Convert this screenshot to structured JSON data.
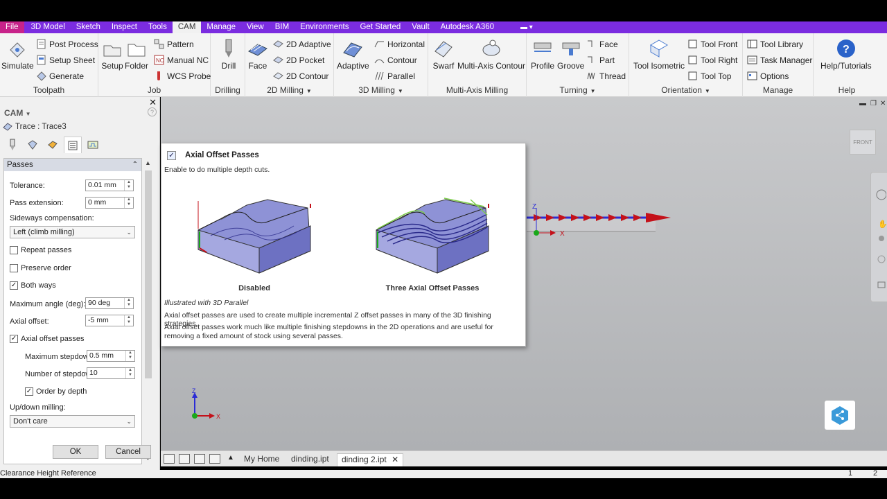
{
  "menu": {
    "items": [
      "File",
      "3D Model",
      "Sketch",
      "Inspect",
      "Tools",
      "CAM",
      "Manage",
      "View",
      "BIM",
      "Environments",
      "Get Started",
      "Vault",
      "Autodesk A360"
    ],
    "active": "CAM"
  },
  "colors": {
    "menubar": "#7b2ce0",
    "file_tab": "#c8238a",
    "accent_blue": "#2a62c9"
  },
  "ribbon": {
    "toolpath": {
      "label": "Toolpath",
      "simulate": "Simulate",
      "post_process": "Post Process",
      "setup_sheet": "Setup Sheet",
      "generate": "Generate"
    },
    "job": {
      "label": "Job",
      "setup": "Setup",
      "folder": "Folder",
      "pattern": "Pattern",
      "manual_nc": "Manual NC",
      "wcs_probe": "WCS Probe"
    },
    "drilling": {
      "label": "Drilling",
      "drill": "Drill"
    },
    "milling2d": {
      "label": "2D Milling",
      "face": "Face",
      "adaptive_2d": "2D Adaptive",
      "pocket_2d": "2D Pocket",
      "contour_2d": "2D Contour"
    },
    "milling3d": {
      "label": "3D Milling",
      "adaptive": "Adaptive",
      "horizontal": "Horizontal",
      "contour": "Contour",
      "parallel": "Parallel"
    },
    "multiaxis": {
      "label": "Multi-Axis Milling",
      "swarf": "Swarf",
      "multi_axis_contour": "Multi-Axis Contour"
    },
    "turning": {
      "label": "Turning",
      "profile": "Profile",
      "groove": "Groove",
      "face": "Face",
      "part": "Part",
      "thread": "Thread"
    },
    "orientation": {
      "label": "Orientation",
      "tool_isometric": "Tool Isometric",
      "tool_front": "Tool Front",
      "tool_right": "Tool Right",
      "tool_top": "Tool Top"
    },
    "manage": {
      "label": "Manage",
      "tool_library": "Tool Library",
      "task_manager": "Task Manager",
      "options": "Options"
    },
    "help": {
      "label": "Help",
      "help_tutorials": "Help/Tutorials"
    }
  },
  "panel": {
    "header": "CAM",
    "operation": "Trace : Trace3",
    "section": "Passes",
    "tolerance_label": "Tolerance:",
    "tolerance_value": "0.01 mm",
    "pass_extension_label": "Pass extension:",
    "pass_extension_value": "0 mm",
    "sideways_label": "Sideways compensation:",
    "sideways_value": "Left (climb milling)",
    "repeat_passes": "Repeat passes",
    "repeat_passes_checked": false,
    "preserve_order": "Preserve order",
    "preserve_order_checked": false,
    "both_ways": "Both ways",
    "both_ways_checked": true,
    "max_angle_label": "Maximum angle (deg):",
    "max_angle_value": "90 deg",
    "axial_offset_label": "Axial offset:",
    "axial_offset_value": "-5 mm",
    "axial_offset_passes": "Axial offset passes",
    "axial_offset_passes_checked": true,
    "max_stepdown_label": "Maximum stepdown",
    "max_stepdown_value": "0.5 mm",
    "num_stepdowns_label": "Number of stepdow",
    "num_stepdowns_value": "10",
    "order_by_depth": "Order by depth",
    "order_by_depth_checked": true,
    "updown_label": "Up/down milling:",
    "updown_value": "Don't care",
    "ok": "OK",
    "cancel": "Cancel"
  },
  "tooltip": {
    "title": "Axial Offset Passes",
    "subtitle": "Enable to do multiple depth cuts.",
    "caption_left": "Disabled",
    "caption_right": "Three Axial Offset Passes",
    "italic": "Illustrated with 3D Parallel",
    "p1": "Axial offset passes are used to create multiple incremental Z offset passes in many of the 3D finishing strategies.",
    "p2": "Axial offset passes work much like multiple finishing stepdowns in the 2D operations and are useful for removing a fixed amount of stock using several passes."
  },
  "viewport": {
    "viewcube_label": "FRONT",
    "axis_z": "Z",
    "axis_x": "X"
  },
  "doctabs": [
    "My Home",
    "dinding.ipt",
    "dinding 2.ipt"
  ],
  "doctab_active": "dinding 2.ipt",
  "status": {
    "text": "Clearance Height Reference",
    "n1": "1",
    "n2": "2"
  }
}
